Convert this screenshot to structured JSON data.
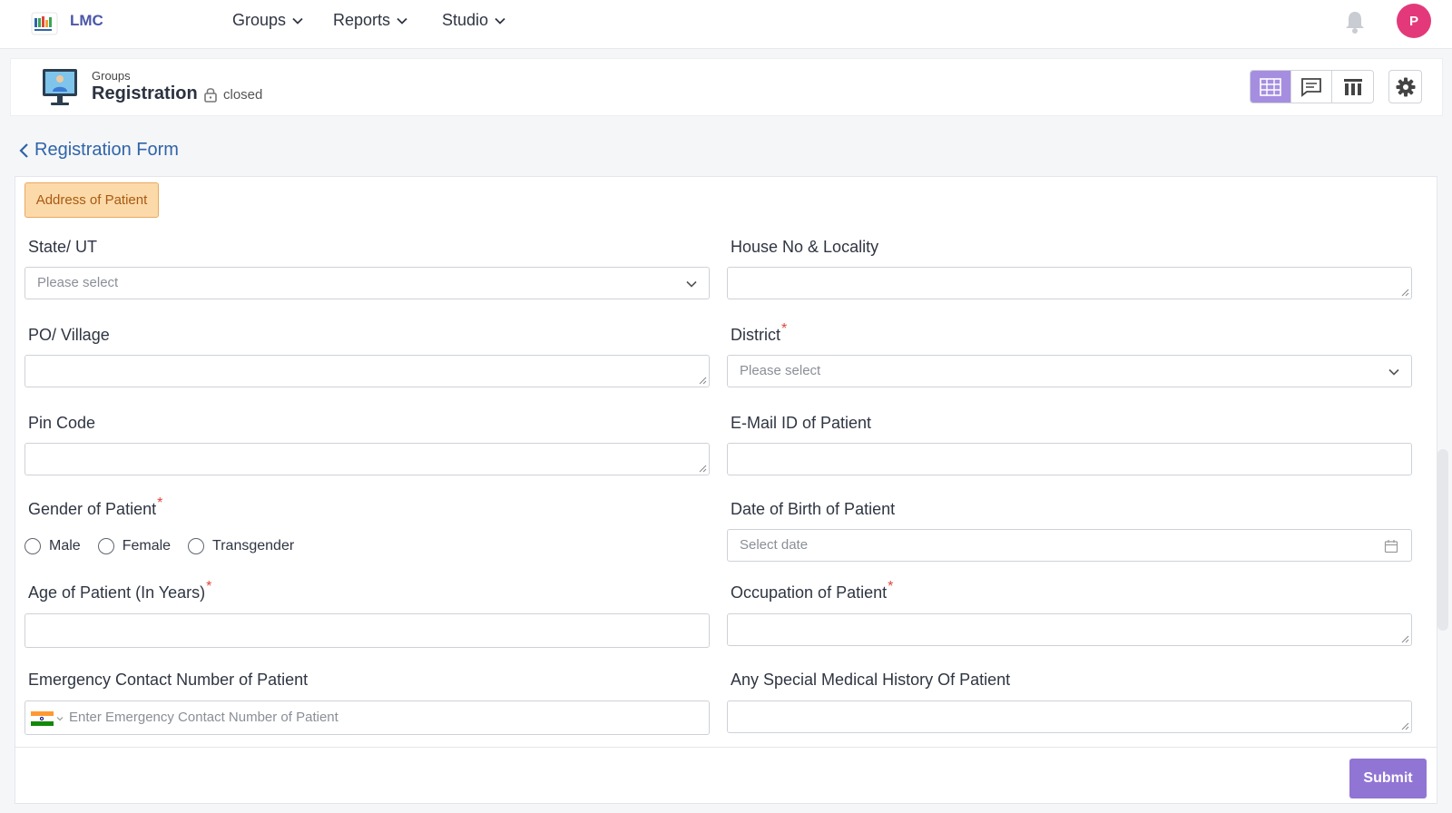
{
  "app": {
    "brand": "LMC",
    "logo_text": "LMC"
  },
  "nav": {
    "items": [
      {
        "label": "Groups"
      },
      {
        "label": "Reports"
      },
      {
        "label": "Studio"
      }
    ],
    "avatar_initial": "P"
  },
  "header": {
    "breadcrumb": "Groups",
    "title": "Registration",
    "status": "closed",
    "view_buttons": [
      "grid-view-icon",
      "comments-icon",
      "columns-icon"
    ],
    "settings_icon": "gear-icon"
  },
  "back_link": "Registration Form",
  "form": {
    "section_tag": "Address of Patient",
    "state_label": "State/ UT",
    "state_placeholder": "Please select",
    "house_label": "House No & Locality",
    "po_label": "PO/ Village",
    "district_label": "District",
    "district_placeholder": "Please select",
    "pin_label": "Pin Code",
    "email_label": "E-Mail ID of Patient",
    "gender_label": "Gender of Patient",
    "gender_options": [
      "Male",
      "Female",
      "Transgender"
    ],
    "dob_label": "Date of Birth of Patient",
    "dob_placeholder": "Select date",
    "age_label": "Age of Patient (In Years)",
    "occupation_label": "Occupation of Patient",
    "emergency_label": "Emergency Contact Number of Patient",
    "emergency_placeholder": "Enter Emergency Contact Number of Patient",
    "history_label": "Any Special Medical History Of Patient",
    "required_mark": "*",
    "submit_label": "Submit"
  },
  "colors": {
    "brand": "#4b57a8",
    "accent": "#9175d4",
    "active_view": "#a58ee0",
    "avatar": "#e3397a",
    "section_tag_bg": "#fcd9a8",
    "required": "#e0453b",
    "link": "#2f64a8"
  }
}
